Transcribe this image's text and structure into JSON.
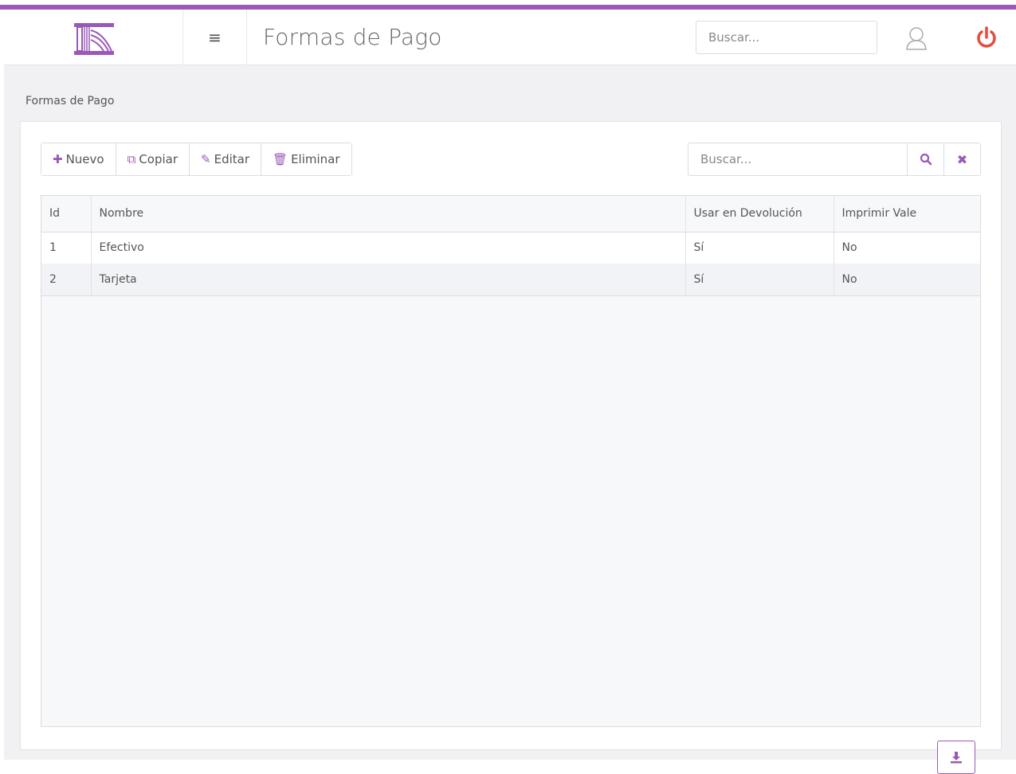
{
  "header": {
    "title": "Formas de Pago",
    "search_placeholder": "Buscar...",
    "menu_icon": "hamburger-icon",
    "user_icon": "user-icon",
    "power_icon": "power-icon"
  },
  "breadcrumb": "Formas de Pago",
  "toolbar": {
    "new_label": "Nuevo",
    "copy_label": "Copiar",
    "edit_label": "Editar",
    "delete_label": "Eliminar"
  },
  "grid_search": {
    "placeholder": "Buscar..."
  },
  "table": {
    "columns": [
      "Id",
      "Nombre",
      "Usar en Devolución",
      "Imprimir Vale"
    ],
    "rows": [
      [
        "1",
        "Efectivo",
        "Sí",
        "No"
      ],
      [
        "2",
        "Tarjeta",
        "Sí",
        "No"
      ]
    ]
  },
  "colors": {
    "accent": "#9b59b6",
    "power": "#e74c3c",
    "background": "#f1f1f4"
  }
}
